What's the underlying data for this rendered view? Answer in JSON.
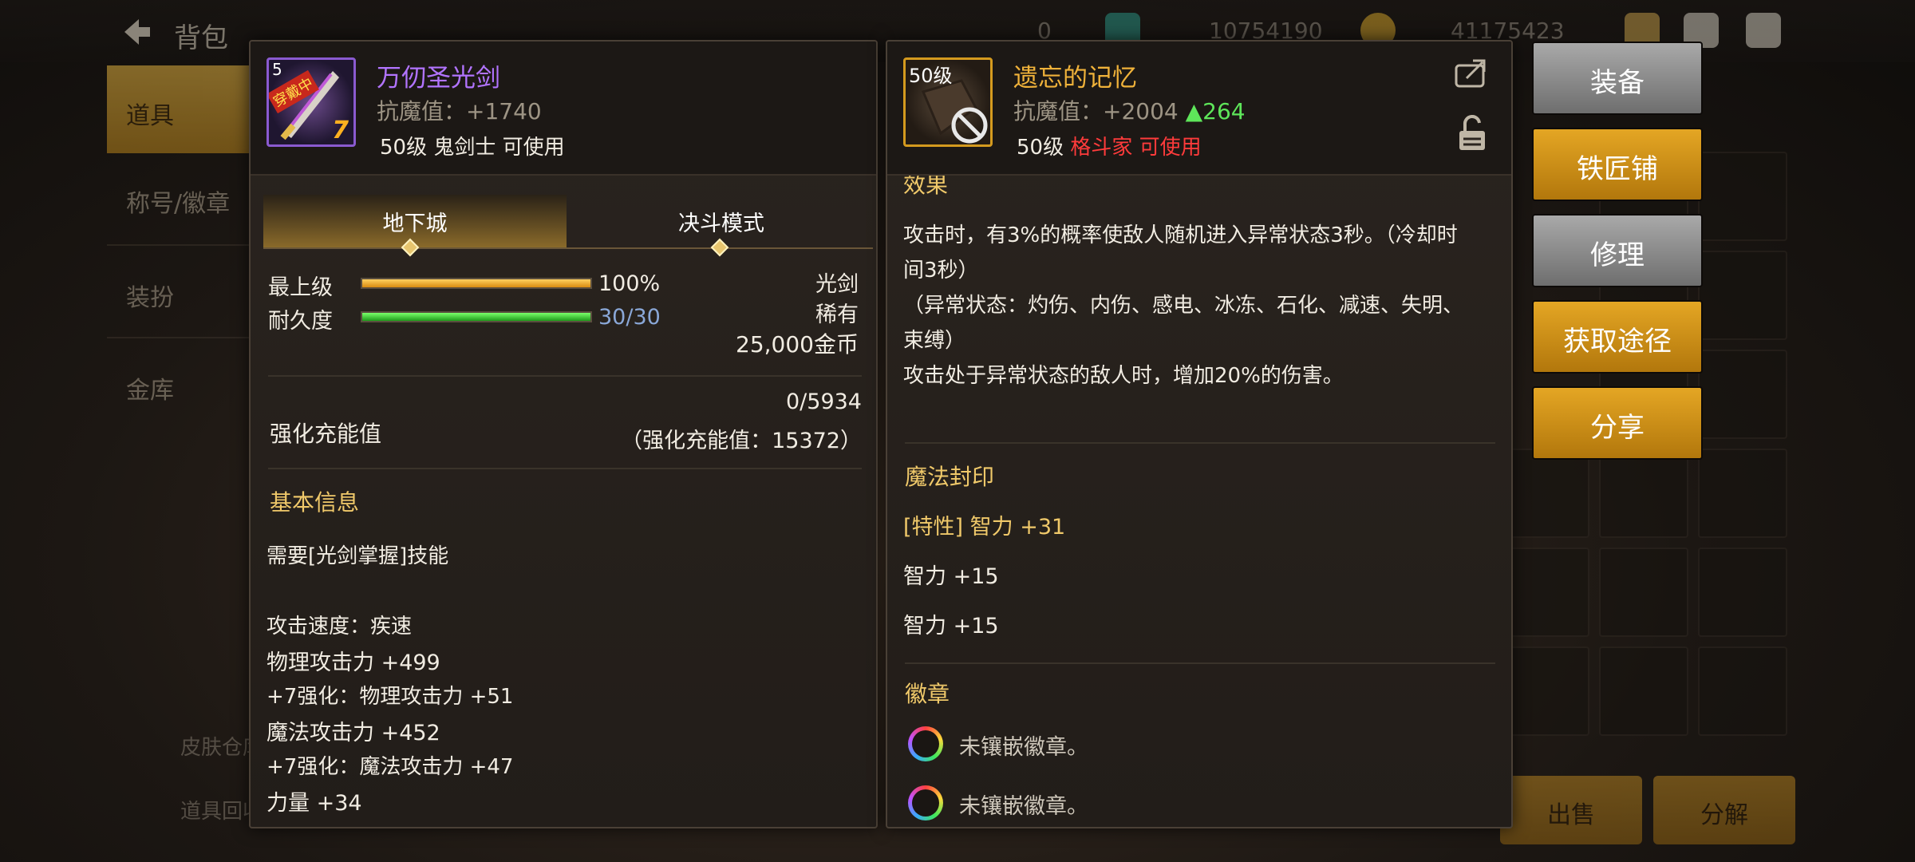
{
  "background": {
    "title": "背包",
    "currency_1": "0",
    "currency_2": "10754190",
    "currency_3": "41175423",
    "nav_items": [
      "道具",
      "称号/徽章",
      "装扮",
      "金库"
    ],
    "bottom_links": [
      "皮肤仓库",
      "道具回收"
    ],
    "bottom_buttons": [
      "出售",
      "分解"
    ]
  },
  "left_item": {
    "icon_badges": {
      "level_digit": "5",
      "equipped": "穿戴中",
      "enhance": "7"
    },
    "name": "万仞圣光剑",
    "resist": "抗魔值：+1740",
    "requirement": "50级 鬼剑士 可使用",
    "tabs": [
      "地下城",
      "决斗模式"
    ],
    "grade_label": "最上级",
    "grade_value": "100%",
    "durability_label": "耐久度",
    "durability_value": "30/30",
    "type": "光剑",
    "rarity": "稀有",
    "price": "25,000金币",
    "charge_label": "强化充能值",
    "charge_value": "0/5934",
    "charge_note": "（强化充能值：15372）",
    "basic_info_title": "基本信息",
    "skill_req": "需要[光剑掌握]技能",
    "attack_speed": "攻击速度：疾速",
    "phys_atk": "物理攻击力 +499",
    "phys_enh": "+7强化：物理攻击力 +51",
    "mag_atk": "魔法攻击力 +452",
    "mag_enh": "+7强化：魔法攻击力 +47",
    "strength": "力量 +34",
    "grade_percent": 100,
    "durability_fraction": 1.0
  },
  "right_item": {
    "level_badge": "50级",
    "name": "遗忘的记忆",
    "resist": "抗魔值：+2004",
    "resist_delta": "▲264",
    "req_level": "50级",
    "req_class": "格斗家 可使用",
    "effect_title": "效果",
    "effect_lines": [
      "攻击时，有3%的概率使敌人随机进入异常状态3秒。（冷却时",
      "间3秒）",
      "（异常状态：灼伤、内伤、感电、冰冻、石化、减速、失明、",
      "束缚）",
      "攻击处于异常状态的敌人时，增加20%的伤害。"
    ],
    "seal_title": "魔法封印",
    "seal_lines": [
      "[特性] 智力 +31",
      "智力 +15",
      "智力 +15"
    ],
    "badge_title": "徽章",
    "badge_lines": [
      "未镶嵌徽章。",
      "未镶嵌徽章。"
    ]
  },
  "actions": [
    "装备",
    "铁匠铺",
    "修理",
    "获取途径",
    "分享"
  ],
  "colors": {
    "rare_purple": "#b274ff",
    "unique_gold": "#f0b23a",
    "cyan": "#3fd6f4",
    "red": "#ff3b3b",
    "green": "#5ee65a"
  }
}
